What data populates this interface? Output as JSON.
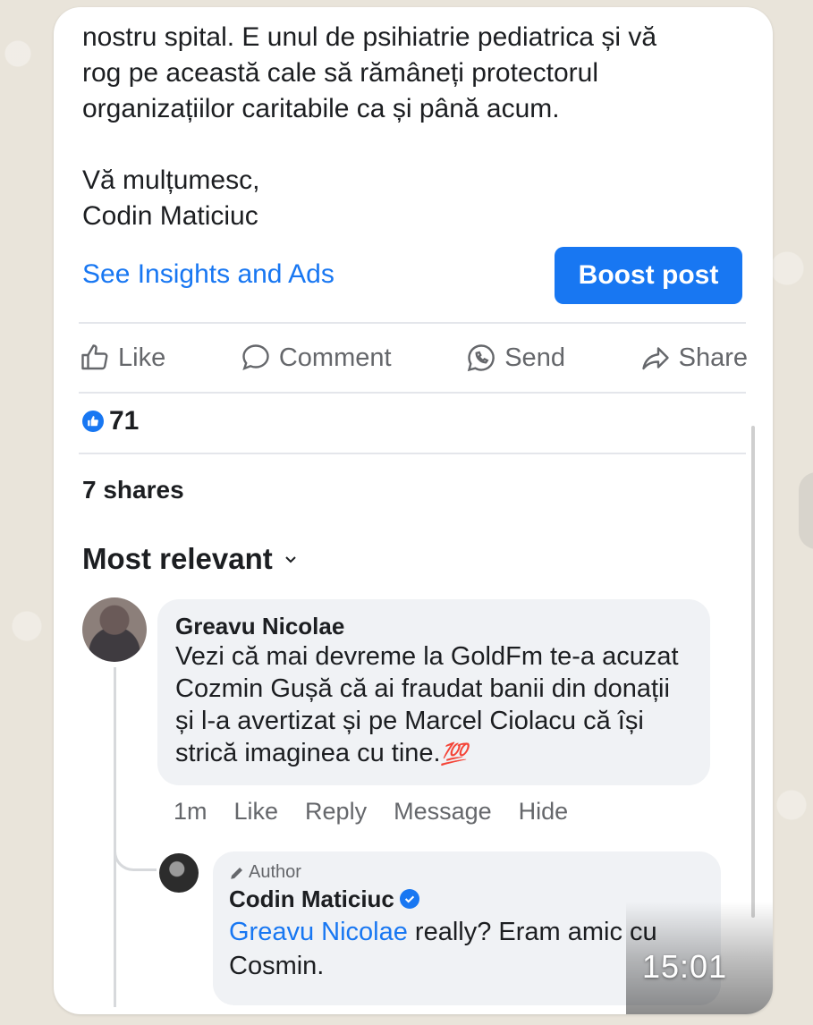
{
  "post": {
    "lines": [
      "nostru spital. E unul de psihiatrie pediatrica și vă",
      "rog pe această cale să rămâneți protectorul",
      "organizațiilor caritabile ca și până acum."
    ],
    "signoff": "Vă mulțumesc,",
    "signature": "Codin Maticiuc"
  },
  "insights_label": "See Insights and Ads",
  "boost_label": "Boost post",
  "actions": {
    "like": "Like",
    "comment": "Comment",
    "send": "Send",
    "share": "Share"
  },
  "reactions_count": "71",
  "shares_label": "7 shares",
  "sort_label": "Most relevant",
  "comment": {
    "author": "Greavu Nicolae",
    "text": "Vezi că mai devreme la GoldFm te-a acuzat Cozmin Gușă că ai fraudat banii din donații și l-a avertizat și pe Marcel Ciolacu că își strică imaginea cu tine.",
    "emoji": "💯",
    "time": "1m",
    "like": "Like",
    "reply": "Reply",
    "message": "Message",
    "hide": "Hide"
  },
  "reply": {
    "author_tag": "Author",
    "author": "Codin Maticiuc",
    "mention": "Greavu Nicolae",
    "text": " really? Eram amic cu Cosmin."
  },
  "video_timestamp": "15:01",
  "colors": {
    "accent": "#1877f2",
    "bubble": "#f0f2f5",
    "muted": "#65676b"
  }
}
